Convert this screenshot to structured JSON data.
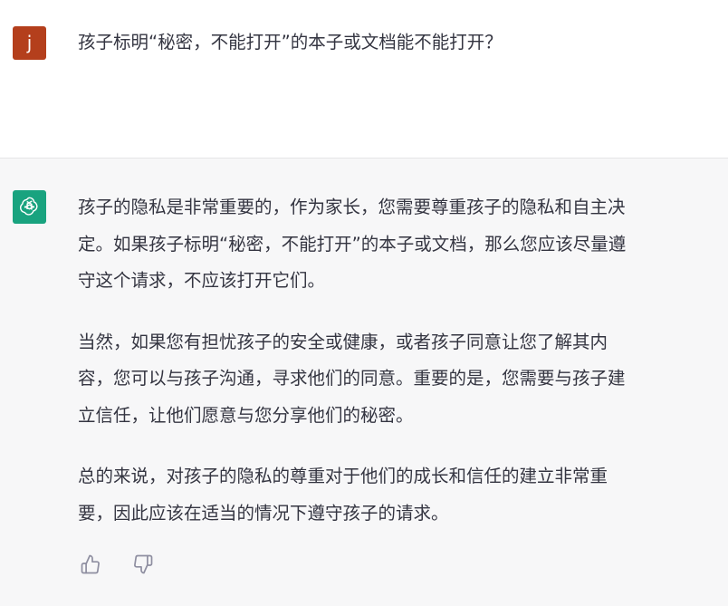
{
  "colors": {
    "user_avatar_bg": "#b43f1c",
    "assistant_avatar_bg": "#19a37f",
    "assistant_bg": "#f7f7f8",
    "text": "#343541",
    "icon": "#8e8ea0"
  },
  "user_message": {
    "avatar_letter": "j",
    "text": "孩子标明“秘密，不能打开”的本子或文档能不能打开？"
  },
  "assistant_message": {
    "avatar_icon": "openai-logo-icon",
    "paragraphs": [
      {
        "lines": [
          "孩子的隐私是非常重要的，作为家长，您需要尊重孩子的隐私和自主决",
          "定。如果孩子标明“秘密，不能打开”的本子或文档，那么您应该尽量遵",
          "守这个请求，不应该打开它们。"
        ]
      },
      {
        "lines": [
          "当然，如果您有担忧孩子的安全或健康，或者孩子同意让您了解其内",
          "容，您可以与孩子沟通，寻求他们的同意。重要的是，您需要与孩子建",
          "立信任，让他们愿意与您分享他们的秘密。"
        ]
      },
      {
        "lines": [
          "总的来说，对孩子的隐私的尊重对于他们的成长和信任的建立非常重",
          "要，因此应该在适当的情况下遵守孩子的请求。"
        ]
      }
    ],
    "feedback": {
      "thumbs_up_icon": "thumbs-up-icon",
      "thumbs_down_icon": "thumbs-down-icon"
    }
  }
}
